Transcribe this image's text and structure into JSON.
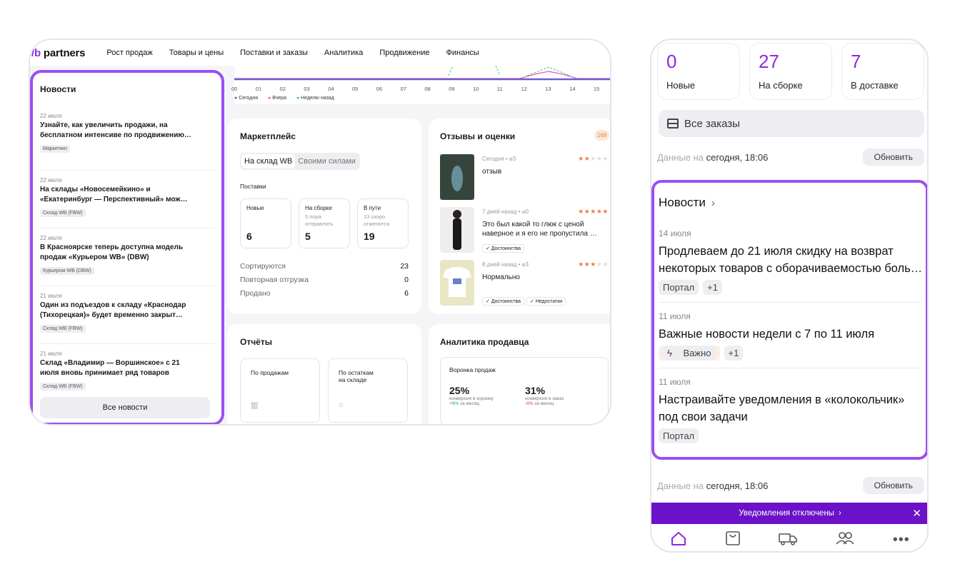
{
  "desktop": {
    "logo_prefix": "b",
    "logo_text": "partners",
    "nav": [
      "Рост продаж",
      "Товары и цены",
      "Поставки и заказы",
      "Аналитика",
      "Продвижение",
      "Финансы"
    ],
    "chart_hours": [
      "00",
      "01",
      "02",
      "03",
      "04",
      "05",
      "06",
      "07",
      "08",
      "09",
      "10",
      "11",
      "12",
      "13",
      "14",
      "15"
    ],
    "chart_legend": [
      "Сегодня",
      "Вчера",
      "Неделю назад"
    ],
    "colors": {
      "today": "#6b5bd6",
      "yesterday": "#e85aa8",
      "week": "#3cc3a0",
      "accent": "#9b4ff0"
    },
    "news": {
      "title": "Новости",
      "items": [
        {
          "date": "22 июля",
          "text": "Узнайте, как увеличить продажи, на бесплатном интенсиве по продвижению…",
          "line1": "Узнайте, как увеличить продажи, на",
          "line2": "бесплатном интенсиве по продвижению…",
          "tag": "Маркетинг"
        },
        {
          "date": "22 июля",
          "line1": "На склады «Новосемейкино» и",
          "line2": "«Екатеринбург — Перспективный» мож…",
          "tag": "Склад WB (FBW)"
        },
        {
          "date": "22 июля",
          "line1": "В Красноярске теперь доступна модель",
          "line2": "продаж «Курьером WB» (DBW)",
          "tag": "Курьером WB (DBW)"
        },
        {
          "date": "21 июля",
          "line1": "Один из подъездов к складу «Краснодар",
          "line2": "(Тихорецкая)» будет временно закрыт…",
          "tag": "Склад WB (FBW)"
        },
        {
          "date": "21 июля",
          "line1": "Склад «Владимир — Воршинское» с 21",
          "line2": "июля вновь принимает ряд товаров",
          "tag": "Склад WB (FBW)"
        }
      ],
      "all_button": "Все новости"
    },
    "marketplace": {
      "title": "Маркетплейс",
      "seg_on": "На склад WB",
      "seg_off": "Своими силами",
      "supplies_label": "Поставки",
      "boxes": [
        {
          "label": "Новые",
          "sub1": "",
          "sub2": "",
          "num": "6"
        },
        {
          "label": "На сборке",
          "sub1": "5 пора",
          "sub2": "отправлять",
          "num": "5"
        },
        {
          "label": "В пути",
          "sub1": "13 скоро",
          "sub2": "отменятся",
          "num": "19"
        }
      ],
      "rows": [
        {
          "label": "Сортируются",
          "value": "23"
        },
        {
          "label": "Повторная отгрузка",
          "value": "0"
        },
        {
          "label": "Продано",
          "value": "6"
        }
      ]
    },
    "reviews": {
      "title": "Отзывы и оценки",
      "count": "168",
      "items": [
        {
          "when": "Сегодня",
          "clips": "3",
          "stars": 2,
          "text1": "отзыв",
          "text2": "",
          "tags": []
        },
        {
          "when": "7 дней назад",
          "clips": "0",
          "stars": 5,
          "text1": "Это был какой то глюк с ценой",
          "text2": "наверное и я его не пропустила …",
          "tags": [
            "✓ Достоинства"
          ]
        },
        {
          "when": "8 дней назад",
          "clips": "3",
          "stars": 3,
          "text1": "Нормально",
          "text2": "",
          "tags": [
            "✓ Достоинства",
            "✓ Недостатки"
          ]
        }
      ]
    },
    "reports": {
      "title": "Отчёты",
      "by_sales": "По продажам",
      "by_stock1": "По остаткам",
      "by_stock2": "на складе"
    },
    "analytics": {
      "title": "Аналитика продавца",
      "funnel": "Воронка продаж",
      "v1": "25%",
      "d1a": "конверсия в корзину",
      "d1b_val": "+9%",
      "d1b": " за месяц",
      "v2": "31%",
      "d2a": "конверсия в заказ",
      "d2b_val": "-8%",
      "d2b": " за месяц"
    }
  },
  "mobile": {
    "stats": [
      {
        "num": "0",
        "label": "Новые"
      },
      {
        "num": "27",
        "label": "На сборке"
      },
      {
        "num": "7",
        "label": "В доставке"
      }
    ],
    "all_orders": "Все заказы",
    "data_on": "Данные на ",
    "data_time": "сегодня, 18:06",
    "refresh": "Обновить",
    "news_title": "Новости",
    "news": [
      {
        "date": "14 июля",
        "line1": "Продлеваем до 21 июля скидку на возврат",
        "line2": "некоторых товаров с оборачиваемостью боль…",
        "tags": [
          "Портал",
          "+1"
        ],
        "important": ""
      },
      {
        "date": "11 июля",
        "line1": "Важные новости недели с 7 по 11 июля",
        "line2": "",
        "tags": [
          "+1"
        ],
        "important": "Важно"
      },
      {
        "date": "11 июля",
        "line1": "Настраивайте уведомления в «колокольчик»",
        "line2": "под свои задачи",
        "tags": [
          "Портал"
        ],
        "important": ""
      }
    ],
    "notif": "Уведомления отключены",
    "tabs": [
      "home-icon",
      "bag-icon",
      "truck-icon",
      "people-icon",
      "more-icon"
    ]
  }
}
